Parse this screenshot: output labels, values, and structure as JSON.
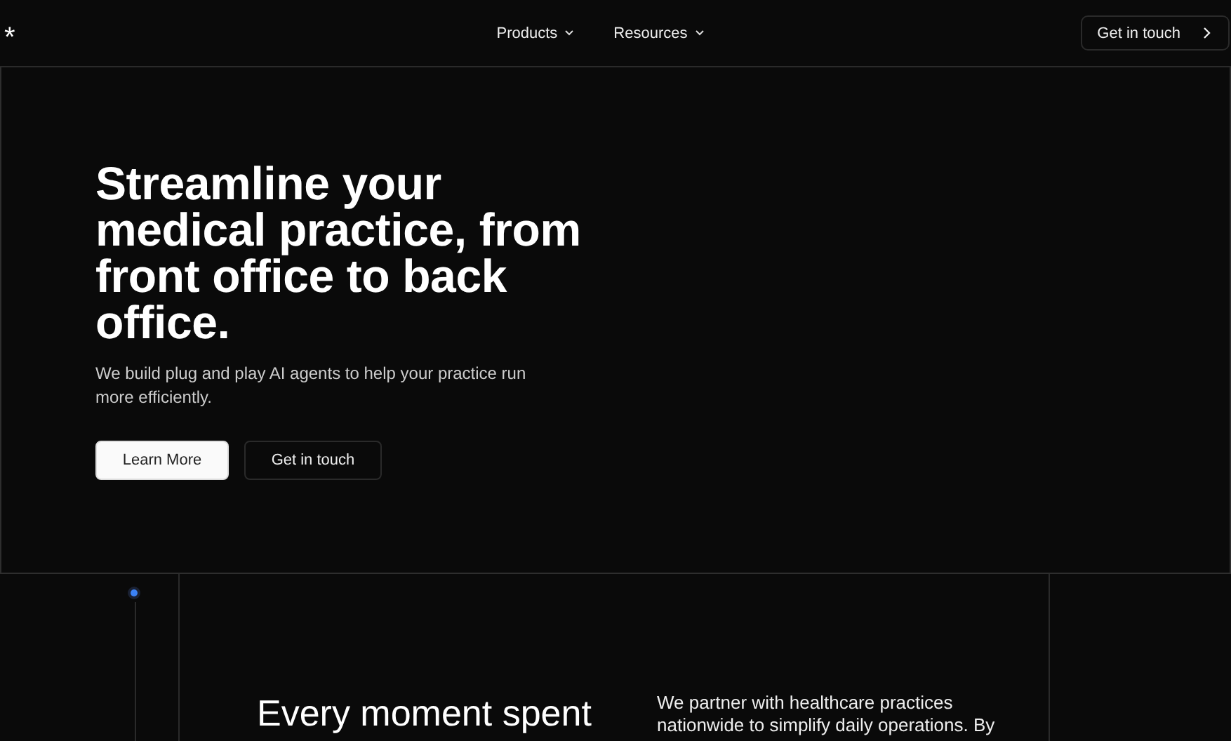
{
  "header": {
    "logo": "*",
    "nav": [
      {
        "label": "Products",
        "dropdown": true
      },
      {
        "label": "Resources",
        "dropdown": true
      }
    ],
    "cta": "Get in touch"
  },
  "hero": {
    "title": "Streamline your medical practice, from front office to back office.",
    "subtitle": "We build plug and play AI agents to help your practice run more efficiently.",
    "buttons": [
      {
        "label": "Learn More",
        "kind": "primary"
      },
      {
        "label": "Get in touch",
        "kind": "secondary"
      }
    ]
  },
  "section": {
    "heading": "Every moment spent",
    "text": "We partner with healthcare practices nationwide to simplify daily operations. By"
  }
}
